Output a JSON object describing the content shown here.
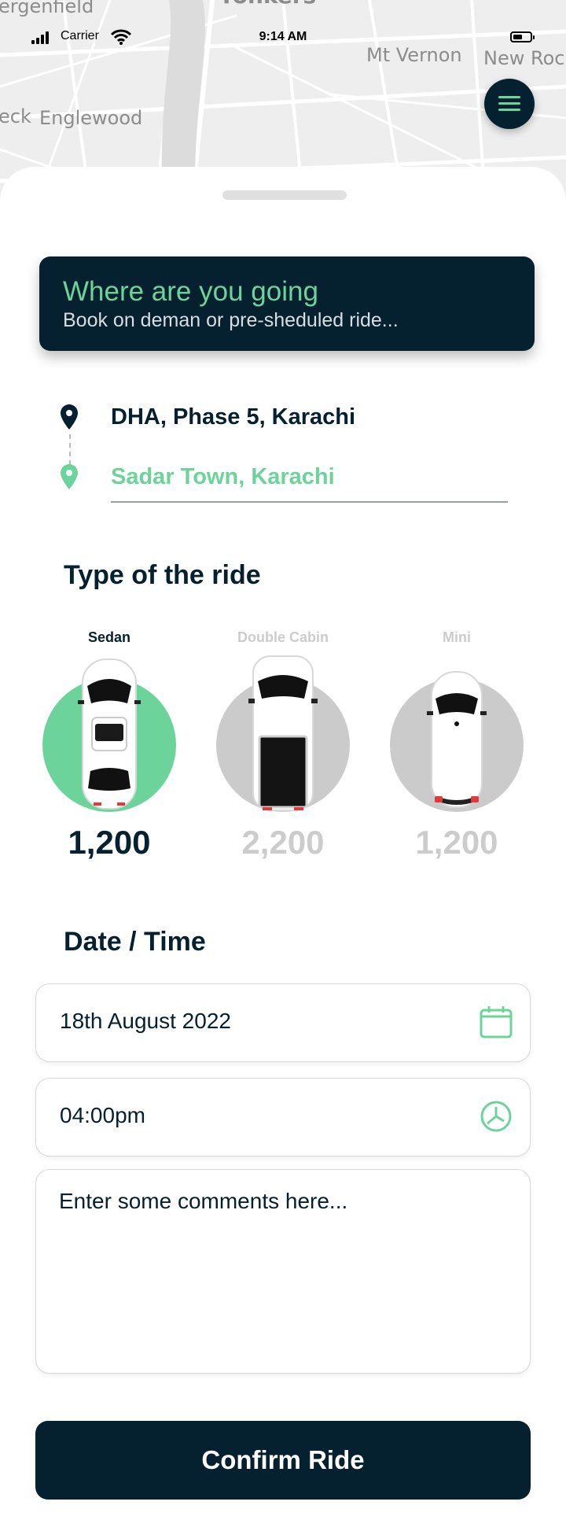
{
  "map": {
    "labels": [
      "ergenfield",
      "Yonkers",
      "Mt Vernon",
      "New Roch",
      "eck",
      "Englewood"
    ]
  },
  "status_bar": {
    "carrier": "Carrier",
    "time": "9:14 AM"
  },
  "menu": {
    "icon": "hamburger-menu-icon"
  },
  "banner": {
    "title": "Where are you going",
    "subtitle": "Book on deman or pre-sheduled ride..."
  },
  "route": {
    "from": "DHA, Phase 5, Karachi",
    "to": "Sadar Town, Karachi"
  },
  "ride_section": {
    "title": "Type of the ride",
    "options": [
      {
        "name": "Sedan",
        "price": "1,200",
        "selected": true
      },
      {
        "name": "Double Cabin",
        "price": "2,200",
        "selected": false
      },
      {
        "name": "Mini",
        "price": "1,200",
        "selected": false
      }
    ]
  },
  "datetime": {
    "title": "Date / Time",
    "date": "18th August 2022",
    "time": "04:00pm",
    "comments_placeholder": "Enter some comments here..."
  },
  "confirm": {
    "label": "Confirm Ride"
  },
  "colors": {
    "primary": "#05202e",
    "accent": "#6cd49a",
    "inactive_text": "#cccccc",
    "inactive_circle": "#cbcbcb"
  }
}
